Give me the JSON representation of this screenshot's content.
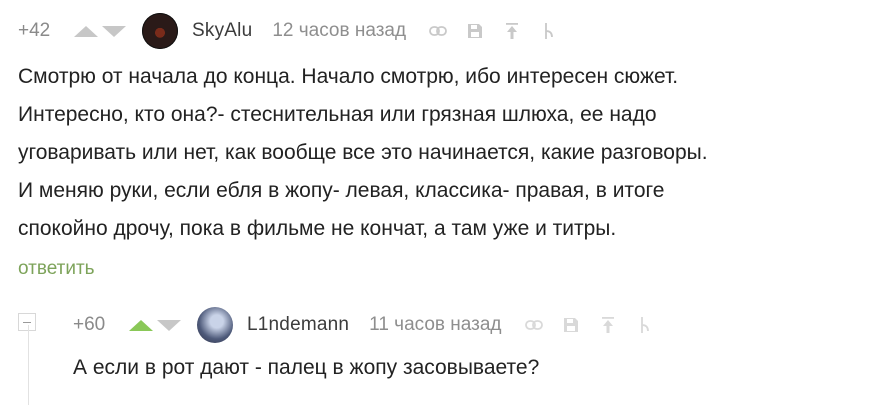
{
  "comment1": {
    "rating": "+42",
    "author": "SkyAlu",
    "time": "12 часов назад",
    "text_lines": [
      "Смотрю от начала до конца. Начало смотрю, ибо интересен сюжет.",
      "Интересно, кто она?- стеснительная или грязная шлюха, ее надо",
      "уговаривать или нет, как вообще все это начинается, какие разговоры.",
      "И меняю руки, если ебля в жопу- левая, классика- правая, в итоге",
      "спокойно дрочу, пока в фильме не кончат, а там уже и титры."
    ],
    "reply_label": "ответить"
  },
  "comment2": {
    "rating": "+60",
    "author": "L1ndemann",
    "time": "11 часов назад",
    "text": "А если в рот дают - палец в жопу засовываете?"
  },
  "icons": [
    "link-icon",
    "save-icon",
    "go-to-parent-icon",
    "branch-icon"
  ],
  "colors": {
    "upvote_active": "#8ac858",
    "vote_inactive": "#c7c7c7",
    "reply_link": "#7da35a",
    "meta_gray": "#8e8e8e"
  }
}
